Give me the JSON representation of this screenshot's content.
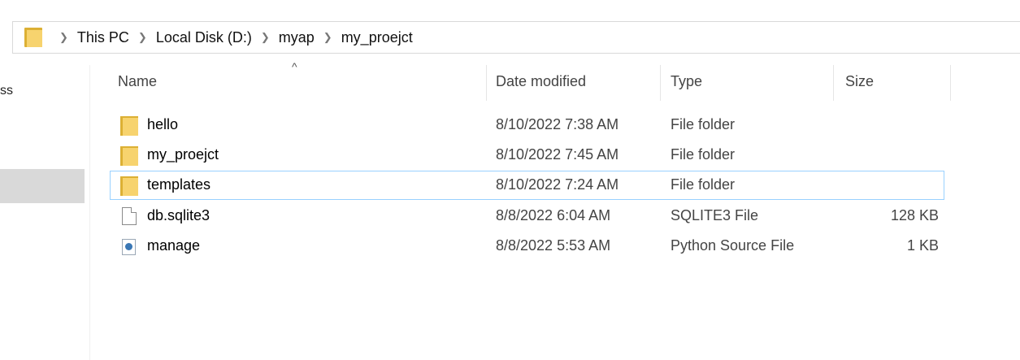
{
  "breadcrumb": [
    "This PC",
    "Local Disk (D:)",
    "myap",
    "my_proejct"
  ],
  "nav": {
    "truncated_label": "ss"
  },
  "columns": {
    "name": "Name",
    "date": "Date modified",
    "type": "Type",
    "size": "Size",
    "sort_indicator": "^"
  },
  "files": [
    {
      "name": "hello",
      "date": "8/10/2022 7:38 AM",
      "type": "File folder",
      "size": "",
      "icon": "folder-icon",
      "selected": false
    },
    {
      "name": "my_proejct",
      "date": "8/10/2022 7:45 AM",
      "type": "File folder",
      "size": "",
      "icon": "folder-icon",
      "selected": false
    },
    {
      "name": "templates",
      "date": "8/10/2022 7:24 AM",
      "type": "File folder",
      "size": "",
      "icon": "folder-icon",
      "selected": true
    },
    {
      "name": "db.sqlite3",
      "date": "8/8/2022 6:04 AM",
      "type": "SQLITE3 File",
      "size": "128 KB",
      "icon": "file-icon",
      "selected": false
    },
    {
      "name": "manage",
      "date": "8/8/2022 5:53 AM",
      "type": "Python Source File",
      "size": "1 KB",
      "icon": "python-file-icon",
      "selected": false
    }
  ],
  "colors": {
    "folder_back": "#dcb034",
    "folder_front": "#f7d36e",
    "selection_border": "#99d1ff",
    "nav_selected": "#d9d9d9"
  }
}
